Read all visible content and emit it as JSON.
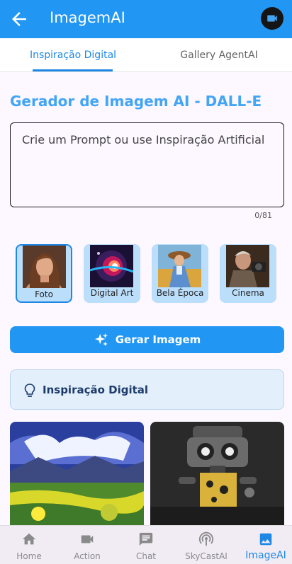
{
  "app": {
    "title": "ImagemAI"
  },
  "tabs": [
    {
      "label": "Inspiração Digital",
      "active": true
    },
    {
      "label": "Gallery AgentAI",
      "active": false
    }
  ],
  "generator": {
    "title": "Gerador de Imagem AI - DALL-E",
    "prompt_placeholder": "Crie um Prompt ou use Inspiração Artificial",
    "char_counter": "0/81",
    "styles": [
      {
        "label": "Foto",
        "selected": true
      },
      {
        "label": "Digital Art",
        "selected": false
      },
      {
        "label": "Bela Época",
        "selected": false
      },
      {
        "label": "Cinema",
        "selected": false
      }
    ],
    "generate_button": "Gerar Imagem"
  },
  "inspiration": {
    "label": "Inspiração Digital"
  },
  "bottom_nav": [
    {
      "label": "Home",
      "icon": "home-icon"
    },
    {
      "label": "Action",
      "icon": "video-icon"
    },
    {
      "label": "Chat",
      "icon": "chat-icon"
    },
    {
      "label": "SkyCastAI",
      "icon": "podcast-icon"
    },
    {
      "label": "ImageAI",
      "icon": "image-icon",
      "active": true
    }
  ],
  "colors": {
    "primary": "#2196f3",
    "tab_active": "#1e88e5",
    "title_blue": "#42a5f5",
    "style_card_bg": "#bbdefb",
    "background": "#fdf7ff"
  }
}
